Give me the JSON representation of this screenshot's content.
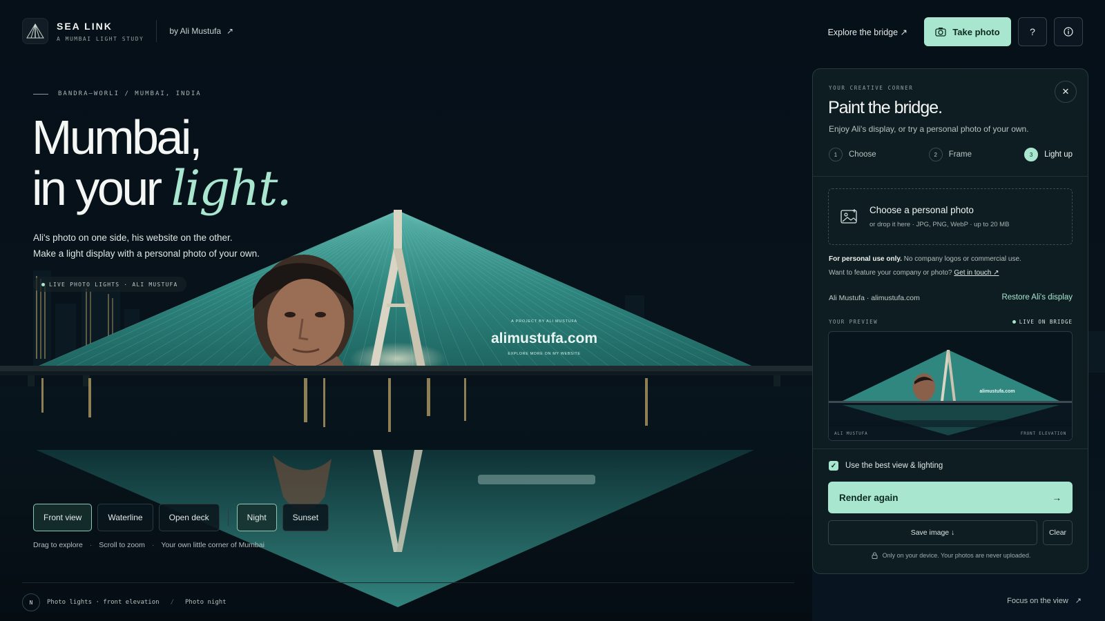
{
  "header": {
    "brand_title": "SEA LINK",
    "brand_subtitle": "A MUMBAI LIGHT STUDY",
    "byline": "by Ali Mustufa",
    "explore_link": "Explore the bridge ↗",
    "take_photo": "Take photo",
    "help_label": "?",
    "info_icon": "info-icon"
  },
  "hero": {
    "eyebrow": "BANDRA–WORLI / MUMBAI, INDIA",
    "line1": "Mumbai,",
    "line2a": "in your ",
    "line2b": "light.",
    "desc1": "Ali's photo on one side, his website on the other.",
    "desc2": "Make a light display with a personal photo of your own.",
    "live_pill": "LIVE PHOTO LIGHTS · ALI MUSTUFA"
  },
  "scene": {
    "site_kicker": "A PROJECT BY ALI MUSTUFA",
    "site_name": "alimustufa.com",
    "site_sub": "EXPLORE MORE ON MY WEBSITE"
  },
  "controls": {
    "views": [
      "Front view",
      "Waterline",
      "Open deck"
    ],
    "active_view": "Front view",
    "lighting": [
      "Night",
      "Sunset"
    ],
    "active_lighting": "Night",
    "hints": [
      "Drag to explore",
      "Scroll to zoom",
      "Your own little corner of Mumbai"
    ]
  },
  "footer": {
    "badge": "N",
    "left_a": "Photo lights · front elevation",
    "left_b": "Photo night",
    "right": "Focus on the view"
  },
  "panel": {
    "eyebrow": "YOUR CREATIVE CORNER",
    "title": "Paint the bridge.",
    "subtitle": "Enjoy Ali's display, or try a personal photo of your own.",
    "steps": [
      {
        "num": "1",
        "label": "Choose"
      },
      {
        "num": "2",
        "label": "Frame"
      },
      {
        "num": "3",
        "label": "Light up"
      }
    ],
    "active_step": 3,
    "drop_title": "Choose a personal photo",
    "drop_sub": "or drop it here · JPG, PNG, WebP · up to 20 MB",
    "note_bold": "For personal use only.",
    "note_rest": " No company logos or commercial use.",
    "note2": "Want to feature your company or photo? ",
    "note2_link": "Get in touch ↗",
    "credit": "Ali Mustufa · alimustufa.com",
    "restore": "Restore Ali's display",
    "preview_label": "YOUR PREVIEW",
    "preview_live": "LIVE ON BRIDGE",
    "preview_caption_left": "ALI MUSTUFA",
    "preview_caption_right": "FRONT ELEVATION",
    "preview_site": "alimustufa.com",
    "checkbox_label": "Use the best view & lighting",
    "checkbox_checked": true,
    "render": "Render again",
    "save": "Save image ↓",
    "clear": "Clear",
    "privacy": "Only on your device. Your photos are never uploaded."
  },
  "colors": {
    "background": "#07111a",
    "accent": "#a9e6d0",
    "sail": "#2c7d78",
    "panel": "#0e1d22"
  }
}
